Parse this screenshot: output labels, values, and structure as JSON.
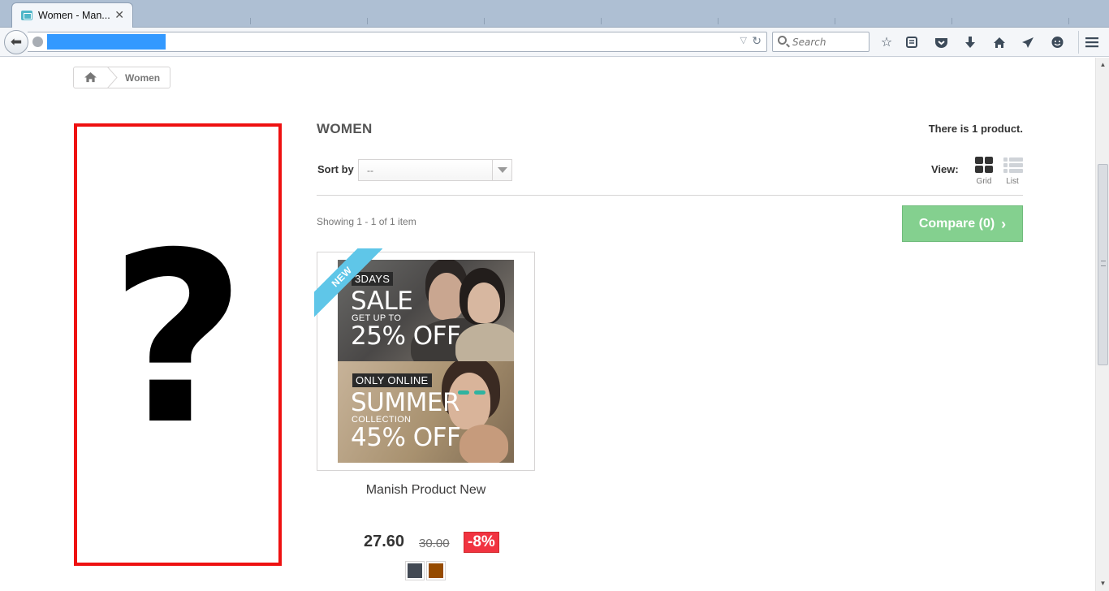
{
  "browser": {
    "tab_title": "Women - Man...",
    "tab_close": "✕",
    "search_placeholder": "Search"
  },
  "breadcrumb": {
    "home_icon": "home-icon",
    "current": "Women"
  },
  "sidebar_placeholder": {
    "glyph": "?",
    "border_color": "#ee1111"
  },
  "category": {
    "title": "WOMEN",
    "product_count": "There is 1 product."
  },
  "sort": {
    "label": "Sort by",
    "selected": "--"
  },
  "view": {
    "label": "View:",
    "grid": "Grid",
    "list": "List"
  },
  "showing": "Showing 1 - 1 of 1 item",
  "compare": {
    "label": "Compare (0)",
    "count": 0
  },
  "product": {
    "ribbon": "NEW",
    "promo_top": {
      "tag": "3DAYS",
      "headline": "SALE",
      "sub": "GET UP TO",
      "offer": "25% OFF"
    },
    "promo_bottom": {
      "tag": "ONLY ONLINE",
      "headline": "SUMMER",
      "sub": "COLLECTION",
      "offer": "45% OFF"
    },
    "name": "Manish Product New",
    "price": "27.60",
    "old_price": "30.00",
    "discount": "-8%",
    "swatches": [
      "#434a54",
      "#964b00"
    ]
  },
  "colors": {
    "compare_bg": "#84d08f",
    "ribbon": "#5fc6e8",
    "discount_bg": "#f13340"
  }
}
